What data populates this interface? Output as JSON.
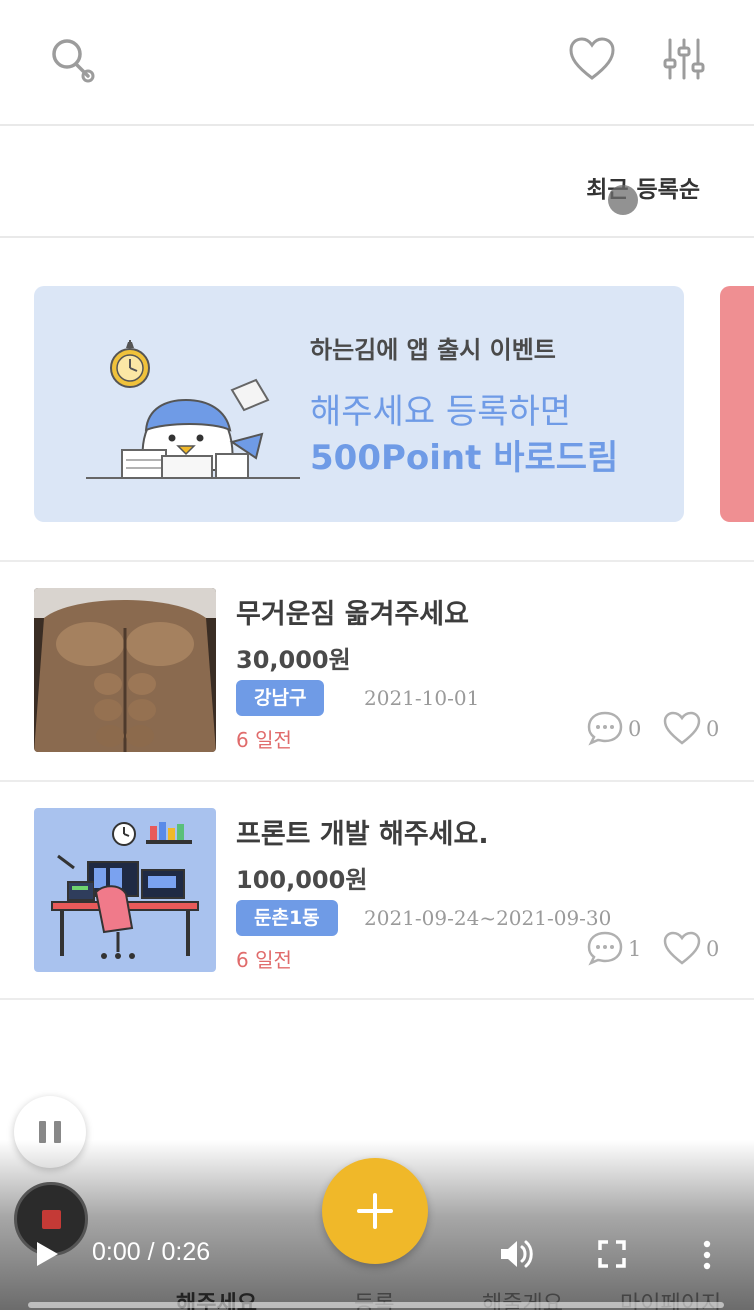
{
  "header": {
    "icons": [
      "search-icon",
      "heart-icon",
      "filter-icon"
    ]
  },
  "sort": {
    "label": "최근 등록순"
  },
  "banner": {
    "subtitle": "하는김에 앱 출시 이벤트",
    "line1": "해주세요 등록하면",
    "line2": "500Point 바로드림",
    "colors": {
      "background": "#dbe6f6",
      "accent": "#6f9be6",
      "next_card": "#ef8f92"
    }
  },
  "posts": [
    {
      "title": "무거운짐 옮겨주세요",
      "price": "30,000원",
      "region": "강남구",
      "date": "2021-10-01",
      "ago": "6 일전",
      "comments": "0",
      "likes": "0"
    },
    {
      "title": "프론트 개발 해주세요.",
      "price": "100,000원",
      "region": "둔촌1동",
      "date": "2021-09-24~2021-09-30",
      "ago": "6 일전",
      "comments": "1",
      "likes": "0"
    }
  ],
  "tabbar": {
    "tabs": [
      "해주세요",
      "등록",
      "해줄게요",
      "마이페이지"
    ],
    "fab_icon": "plus-icon",
    "fab_color": "#f0b829"
  },
  "video": {
    "time": "0:00 / 0:26",
    "progress": 0
  }
}
